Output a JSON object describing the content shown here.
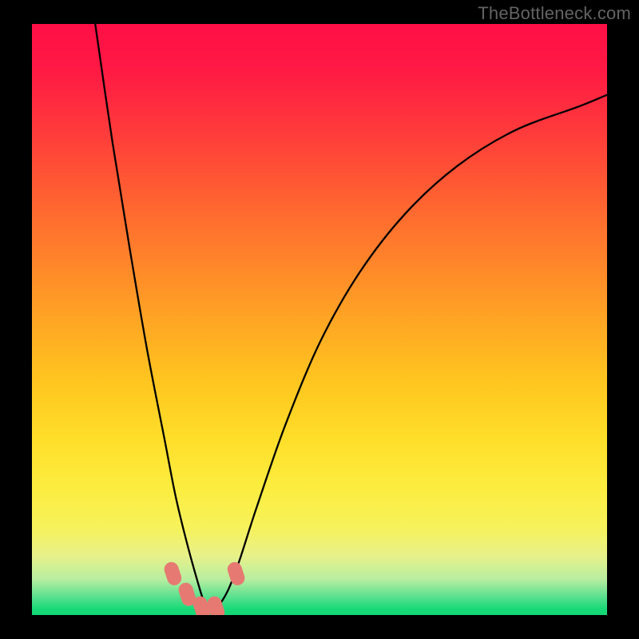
{
  "watermark": "TheBottleneck.com",
  "chart_data": {
    "type": "line",
    "title": "",
    "xlabel": "",
    "ylabel": "",
    "xlim": [
      0,
      100
    ],
    "ylim": [
      0,
      100
    ],
    "grid": false,
    "series": [
      {
        "name": "bottleneck-curve",
        "x": [
          11,
          14,
          17,
          20,
          23,
          25,
          27,
          29,
          30,
          31,
          32,
          34,
          36,
          39,
          44,
          50,
          57,
          65,
          74,
          84,
          95,
          100
        ],
        "y": [
          100,
          80,
          62,
          45,
          30,
          20,
          12,
          5,
          2,
          0.5,
          1,
          4,
          9,
          18,
          32,
          46,
          58,
          68,
          76,
          82,
          86,
          88
        ]
      }
    ],
    "markers": [
      {
        "x": 24.5,
        "y": 7,
        "w": 2.5,
        "h": 4
      },
      {
        "x": 27.0,
        "y": 3.5,
        "w": 2.5,
        "h": 4
      },
      {
        "x": 29.5,
        "y": 1.2,
        "w": 2.5,
        "h": 4
      },
      {
        "x": 32.0,
        "y": 1.2,
        "w": 2.5,
        "h": 4
      },
      {
        "x": 35.5,
        "y": 7,
        "w": 2.5,
        "h": 4
      }
    ],
    "gradient_stops": [
      {
        "pos": 0,
        "color": "#ff0f46"
      },
      {
        "pos": 30,
        "color": "#ff6331"
      },
      {
        "pos": 60,
        "color": "#ffc41f"
      },
      {
        "pos": 85,
        "color": "#f7f25a"
      },
      {
        "pos": 97,
        "color": "#57e08e"
      },
      {
        "pos": 100,
        "color": "#13d777"
      }
    ]
  }
}
